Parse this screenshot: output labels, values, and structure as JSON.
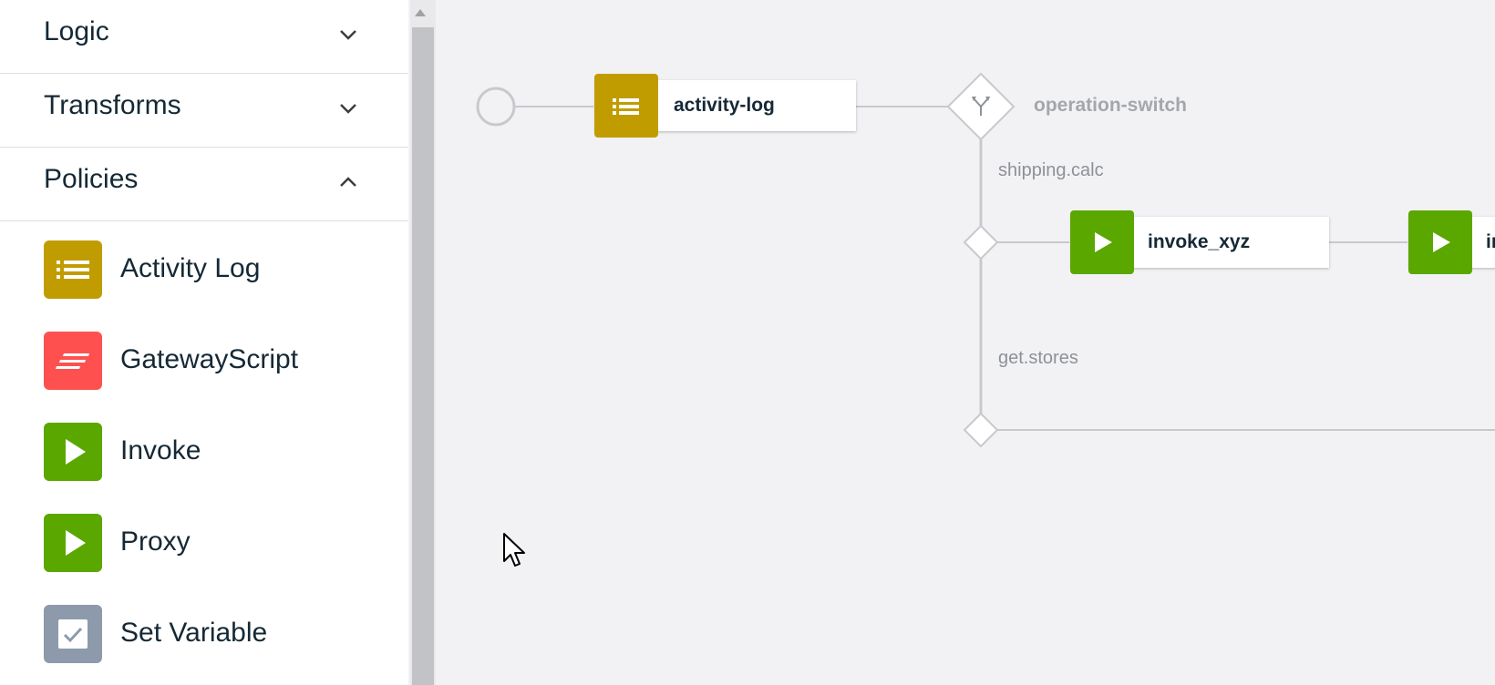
{
  "sidebar": {
    "sections": [
      {
        "label": "Logic",
        "expanded": false
      },
      {
        "label": "Transforms",
        "expanded": false
      },
      {
        "label": "Policies",
        "expanded": true
      }
    ],
    "policies": [
      {
        "label": "Activity Log",
        "icon": "list-icon",
        "color": "#c19c00"
      },
      {
        "label": "GatewayScript",
        "icon": "script-icon",
        "color": "#ff5050"
      },
      {
        "label": "Invoke",
        "icon": "play-icon",
        "color": "#5aa700"
      },
      {
        "label": "Proxy",
        "icon": "play-icon",
        "color": "#5aa700"
      },
      {
        "label": "Set Variable",
        "icon": "checkbox-icon",
        "color": "#8c9aab"
      }
    ]
  },
  "canvas": {
    "nodes": {
      "activity_log": {
        "label": "activity-log",
        "icon": "list-icon",
        "color": "#c19c00"
      },
      "operation_switch": {
        "label": "operation-switch",
        "icon": "switch-icon"
      },
      "invoke_xyz": {
        "label": "invoke_xyz",
        "icon": "play-icon",
        "color": "#5aa700"
      },
      "invoke_partial": {
        "label": "in",
        "icon": "play-icon",
        "color": "#5aa700"
      }
    },
    "cases": [
      "shipping.calc",
      "get.stores"
    ]
  }
}
